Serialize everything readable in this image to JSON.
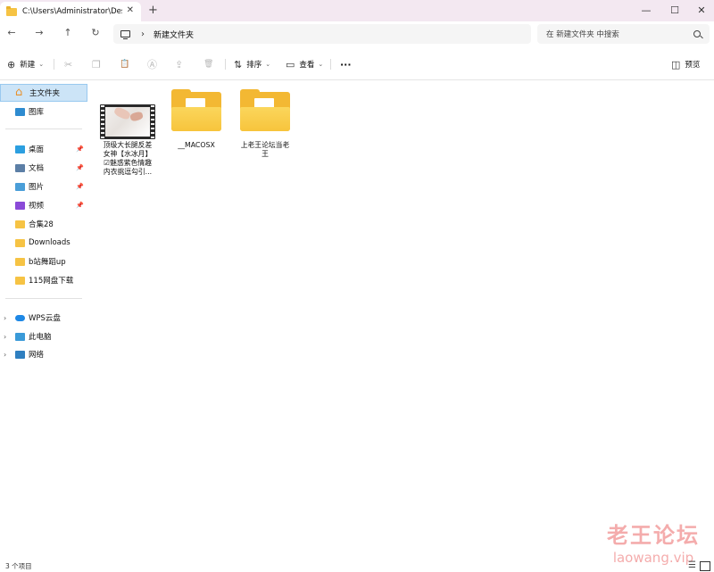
{
  "window": {
    "tab_title": "C:\\Users\\Administrator\\Deskto",
    "tab_close": "✕",
    "new_tab": "+",
    "controls": {
      "minimize": "—",
      "maximize": "☐",
      "close": "✕"
    }
  },
  "nav": {
    "back": "←",
    "forward": "→",
    "up": "↑",
    "refresh": "↻"
  },
  "address": {
    "separator": "›",
    "current": "新建文件夹"
  },
  "search": {
    "placeholder": "在 新建文件夹 中搜索"
  },
  "commands": {
    "new_label": "新建",
    "new_icon": "⊕",
    "cut_icon": "✂",
    "copy_icon": "❐",
    "paste_icon": "📋",
    "rename_icon": "Ⓐ",
    "share_icon": "⇪",
    "delete_icon": "🗑",
    "sort_label": "排序",
    "sort_icon": "⇅",
    "view_label": "查看",
    "view_icon": "▭",
    "more": "···",
    "preview_label": "预览",
    "preview_icon": "◫",
    "caret": "⌄"
  },
  "sidebar": {
    "items": [
      {
        "label": "主文件夹",
        "icon": "home-icon"
      },
      {
        "label": "图库",
        "icon": "gallery-icon"
      },
      {
        "label": "桌面",
        "icon": "desktop-icon",
        "pinned": true
      },
      {
        "label": "文档",
        "icon": "document-icon",
        "pinned": true
      },
      {
        "label": "图片",
        "icon": "pictures-icon",
        "pinned": true
      },
      {
        "label": "视频",
        "icon": "videos-icon",
        "pinned": true
      },
      {
        "label": "合集28",
        "icon": "folder-icon"
      },
      {
        "label": "Downloads",
        "icon": "folder-icon"
      },
      {
        "label": "b站舞蹈up",
        "icon": "folder-icon"
      },
      {
        "label": "115网盘下载",
        "icon": "folder-icon"
      },
      {
        "label": "WPS云盘",
        "icon": "cloud-icon"
      },
      {
        "label": "此电脑",
        "icon": "pc-icon"
      },
      {
        "label": "网络",
        "icon": "network-icon"
      }
    ],
    "pin_glyph": "📌",
    "expand_glyph": "›"
  },
  "files": [
    {
      "name_line1": "顶级大长腿反差",
      "name_line2": "女神【水冰月】",
      "name_line3": "☑魅惑紫色情趣",
      "name_line4": "内衣挑逗勾引...",
      "type": "video"
    },
    {
      "name": "__MACOSX",
      "type": "folder"
    },
    {
      "name_line1": "上老王论坛当老",
      "name_line2": "王",
      "type": "folder"
    }
  ],
  "status": {
    "count": "3 个项目",
    "list_view": "☰"
  },
  "watermark": {
    "cn": "老王论坛",
    "en": "laowang.vip"
  },
  "colors": {
    "accent": "#0067c0",
    "selected_bg": "#cce4f7",
    "folder": "#f6c344",
    "titlebar": "#f3e8f1"
  }
}
